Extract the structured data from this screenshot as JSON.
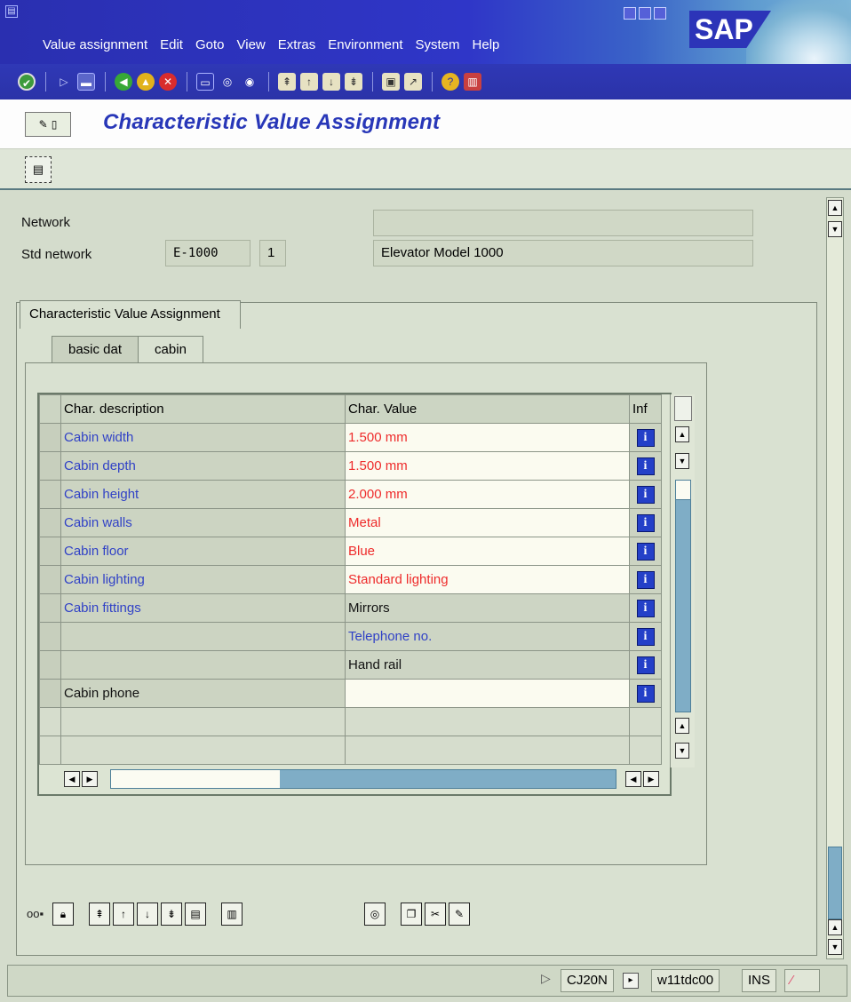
{
  "menu": [
    "Value assignment",
    "Edit",
    "Goto",
    "View",
    "Extras",
    "Environment",
    "System",
    "Help"
  ],
  "logo": "SAP",
  "title": "Characteristic Value Assignment",
  "header": {
    "network_label": "Network",
    "network_value": "",
    "std_network_label": "Std network",
    "std_network_value": "E-1000",
    "std_network_counter": "1",
    "std_network_desc": "Elevator Model 1000"
  },
  "group_title": "Characteristic Value Assignment",
  "tabs": [
    "basic dat",
    "cabin"
  ],
  "active_tab": "cabin",
  "table": {
    "columns": [
      "Char. description",
      "Char. Value",
      "Inf"
    ],
    "rows": [
      {
        "desc": "Cabin width",
        "value": "1.500 mm"
      },
      {
        "desc": "Cabin depth",
        "value": "1.500 mm"
      },
      {
        "desc": "Cabin height",
        "value": "2.000 mm"
      },
      {
        "desc": "Cabin walls",
        "value": "Metal"
      },
      {
        "desc": "Cabin floor",
        "value": "Blue"
      },
      {
        "desc": "Cabin lighting",
        "value": "Standard lighting"
      },
      {
        "desc": "Cabin fittings",
        "value": "Mirrors"
      },
      {
        "desc": "",
        "value": "Telephone no."
      },
      {
        "desc": "",
        "value": "Hand rail"
      },
      {
        "desc": "Cabin phone",
        "value": ""
      }
    ],
    "info_glyph": "i"
  },
  "status": {
    "transaction": "CJ20N",
    "server": "w11tdc00",
    "mode": "INS"
  },
  "colors": {
    "accent": "#2837b8",
    "required_value": "#ee2b2b",
    "char_link": "#3142c6"
  }
}
